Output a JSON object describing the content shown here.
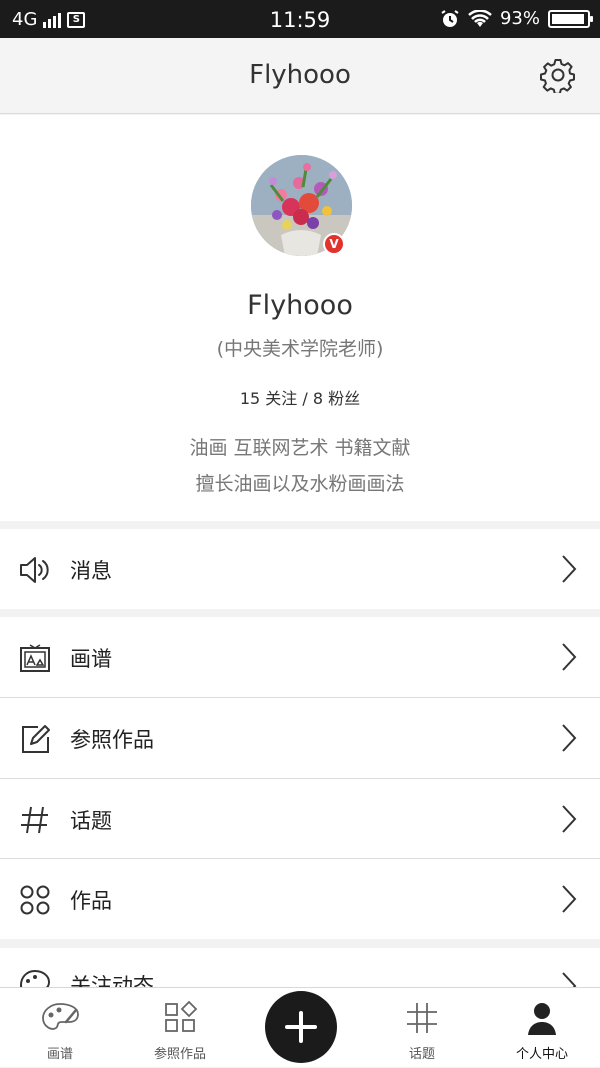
{
  "status": {
    "network": "4G",
    "time": "11:59",
    "battery": "93%",
    "battery_level": 0.93
  },
  "header": {
    "title": "Flyhooo"
  },
  "profile": {
    "name": "Flyhooo",
    "title": "(中央美术学院老师)",
    "stats": "15 关注 / 8 粉丝",
    "verified_badge": "V",
    "desc_line1": "油画 互联网艺术 书籍文献",
    "desc_line2": "擅长油画以及水粉画画法"
  },
  "menu": [
    {
      "label": "消息",
      "icon": "speaker-icon"
    },
    {
      "label": "画谱",
      "icon": "picture-frame-icon"
    },
    {
      "label": "参照作品",
      "icon": "edit-icon"
    },
    {
      "label": "话题",
      "icon": "hash-icon"
    },
    {
      "label": "作品",
      "icon": "grid-circles-icon"
    },
    {
      "label": "关注动态",
      "icon": "palette-icon"
    }
  ],
  "tabs": [
    {
      "label": "画谱",
      "icon": "palette-icon"
    },
    {
      "label": "参照作品",
      "icon": "shapes-icon"
    },
    {
      "label": "话题",
      "icon": "hash-icon"
    },
    {
      "label": "个人中心",
      "icon": "person-icon"
    }
  ],
  "colors": {
    "accent": "#1b1b1b",
    "badge": "#e0332d",
    "background": "#f2f2f2"
  }
}
